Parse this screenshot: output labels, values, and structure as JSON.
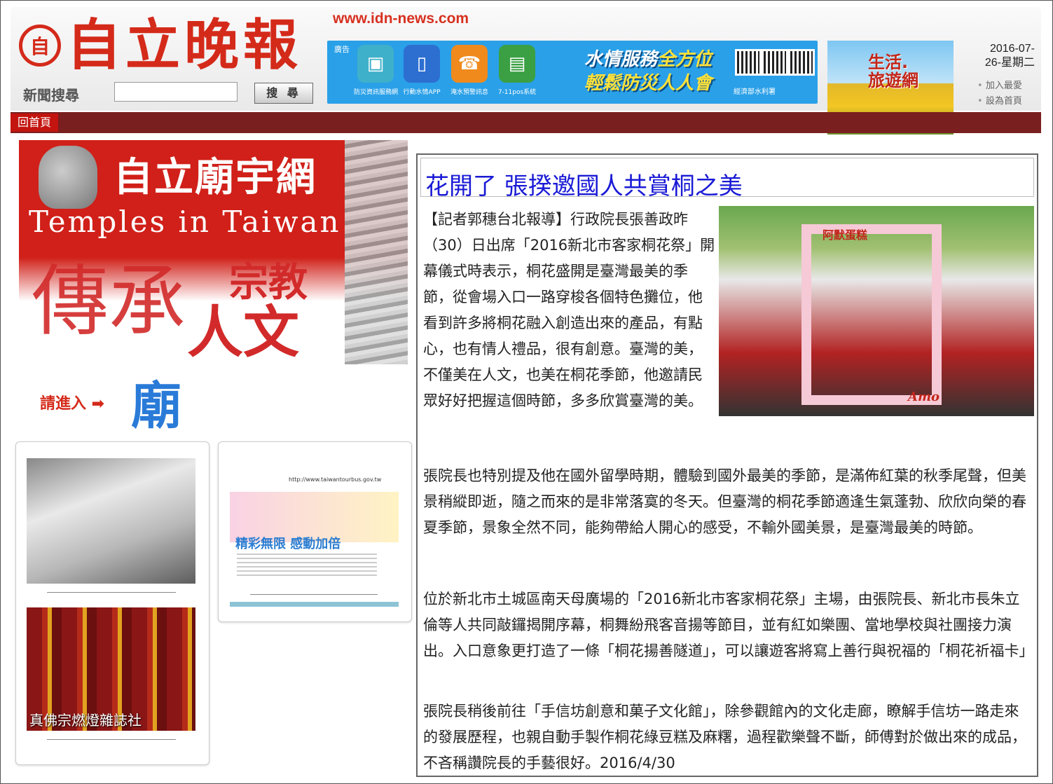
{
  "header": {
    "logo_badge": "自",
    "logo_text": "自立晚報",
    "url": "www.idn-news.com",
    "search_label": "新聞搜尋",
    "search_value": "",
    "search_button": "搜 尋"
  },
  "banner": {
    "ad_tag": "廣告",
    "apps": [
      {
        "icon": "monitor-icon",
        "caption": "防災資訊服務網"
      },
      {
        "icon": "phone-icon",
        "caption": "行動水情APP"
      },
      {
        "icon": "telephone-icon",
        "caption": "淹水預警訊息"
      },
      {
        "icon": "store-icon",
        "caption": "7-11pos系統"
      }
    ],
    "slogan_line1_a": "水情服務",
    "slogan_line1_b": "全方位",
    "slogan_line2": "輕鬆防災人人會",
    "org": "經濟部水利署"
  },
  "travel_ad": {
    "title_line1": "生活.",
    "title_line2": "旅遊網"
  },
  "date": {
    "line1": "2016-07-",
    "line2": "26-星期二"
  },
  "links": {
    "favorite": "加入最愛",
    "homepage": "設為首頁"
  },
  "nav": {
    "home": "回首頁"
  },
  "temple_ad": {
    "title": "自立廟宇網",
    "subtitle": "Temples in Taiwan",
    "big1": "傳承",
    "big2": "宗教",
    "big3": "人文",
    "enter": "請進入 ➡",
    "temple": "廟"
  },
  "side_ads": {
    "buddha_caption": "真佛宗燃燈雜誌社",
    "tour_url": "http://www.taiwantourbus.gov.tw",
    "tour_tagline": "精彩無限 感動加倍"
  },
  "article": {
    "title": "花開了 張揆邀國人共賞桐之美",
    "photo_brand": "阿默蛋糕",
    "photo_mark": "Amo",
    "p1": "【記者郭穗台北報導】行政院長張善政昨（30）日出席「2016新北市客家桐花祭」開幕儀式時表示，桐花盛開是臺灣最美的季節，從會場入口一路穿梭各個特色攤位，他看到許多將桐花融入創造出來的產品，有點心，也有情人禮品，很有創意。臺灣的美，不僅美在人文，也美在桐花季節，他邀請民眾好好把握這個時節，多多欣賞臺灣的美。",
    "p2": "張院長也特別提及他在國外留學時期，體驗到國外最美的季節，是滿佈紅葉的秋季尾聲，但美景稍縱即逝，隨之而來的是非常落寞的冬天。但臺灣的桐花季節適逢生氣蓬勃、欣欣向榮的春夏季節，景象全然不同，能夠帶給人開心的感受，不輸外國美景，是臺灣最美的時節。",
    "p3": "位於新北市土城區南天母廣場的「2016新北市客家桐花祭」主場，由張院長、新北市長朱立倫等人共同敲鑼揭開序幕，桐舞紛飛客音揚等節目，並有紅如樂團、當地學校與社團接力演出。入口意象更打造了一條「桐花揚善隧道」，可以讓遊客將寫上善行與祝福的「桐花祈福卡」懸掛在兩旁。",
    "p4": "張院長稍後前往「手信坊創意和菓子文化館」，除參觀館內的文化走廊，瞭解手信坊一路走來的發展歷程，也親自動手製作桐花綠豆糕及麻糬，過程歡樂聲不斷，師傅對於做出來的成品，不吝稱讚院長的手藝很好。2016/4/30"
  }
}
